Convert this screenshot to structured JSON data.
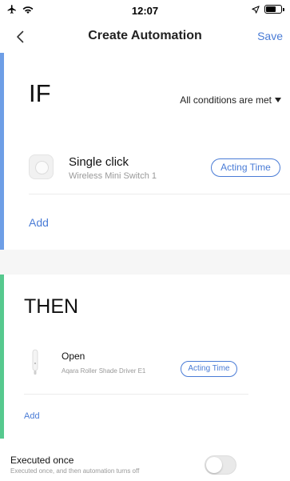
{
  "status_bar": {
    "time": "12:07",
    "battery_level": 0.6,
    "icons": [
      "airplane-icon",
      "wifi-icon",
      "location-arrow-icon",
      "battery-icon"
    ]
  },
  "nav": {
    "title": "Create Automation",
    "save_label": "Save",
    "back_icon": "chevron-left-icon"
  },
  "if_section": {
    "heading": "IF",
    "conditions_label": "All conditions are met",
    "condition": {
      "title": "Single click",
      "device": "Wireless Mini Switch 1",
      "acting_time_label": "Acting Time",
      "icon": "mini-switch-icon"
    },
    "add_label": "Add"
  },
  "then_section": {
    "heading": "THEN",
    "action": {
      "title": "Open",
      "device": "Aqara Roller Shade Driver E1",
      "acting_time_label": "Acting Time",
      "icon": "roller-shade-icon"
    },
    "add_label": "Add"
  },
  "executed_once": {
    "title": "Executed once",
    "description": "Executed once, and then automation turns off",
    "enabled": false
  },
  "colors": {
    "accent": "#4a7cd6",
    "if_bar": "#6e9ee6",
    "then_bar": "#56c98e"
  }
}
